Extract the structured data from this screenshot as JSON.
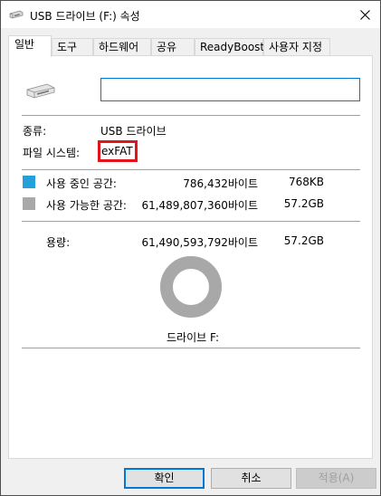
{
  "window": {
    "title": "USB 드라이브 (F:) 속성",
    "icons": {
      "title": "usb-drive-icon",
      "close": "close-icon",
      "drive": "usb-drive-icon"
    }
  },
  "tabs": [
    {
      "label": "일반",
      "active": true
    },
    {
      "label": "도구",
      "active": false
    },
    {
      "label": "하드웨어",
      "active": false
    },
    {
      "label": "공유",
      "active": false
    },
    {
      "label": "ReadyBoost",
      "active": false
    },
    {
      "label": "사용자 지정",
      "active": false
    }
  ],
  "general": {
    "name_value": "",
    "type_label": "종류:",
    "type_value": "USB 드라이브",
    "fs_label": "파일 시스템:",
    "fs_value": "exFAT",
    "fs_highlight_color": "#e5141b",
    "used": {
      "label": "사용 중인 공간:",
      "bytes": "786,432바이트",
      "size": "768KB",
      "color": "#26a0da"
    },
    "free": {
      "label": "사용 가능한 공간:",
      "bytes": "61,489,807,360바이트",
      "size": "57.2GB",
      "color": "#a8a8a8"
    },
    "capacity": {
      "label": "용량:",
      "bytes": "61,490,593,792바이트",
      "size": "57.2GB"
    },
    "drive_label": "드라이브 F:",
    "usage_fraction_used": 1.28e-05
  },
  "buttons": {
    "ok": "확인",
    "cancel": "취소",
    "apply": "적용(A)"
  }
}
